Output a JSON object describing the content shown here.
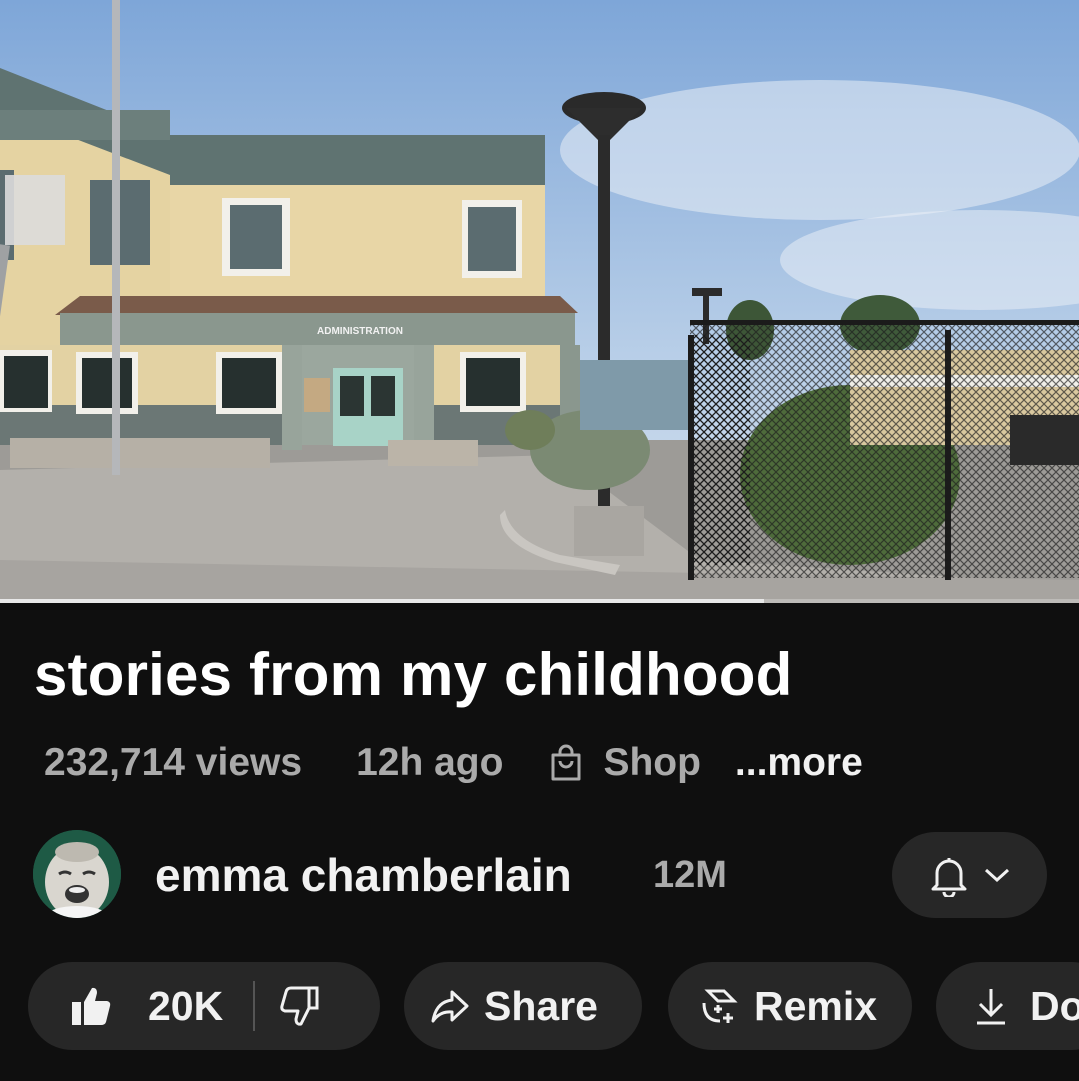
{
  "video": {
    "sign_text": "ADMINISTRATION",
    "progress": 0.708
  },
  "title": "stories from my childhood",
  "meta": {
    "views": "232,714 views",
    "age": "12h ago",
    "shop_label": "Shop",
    "more_label": "...more"
  },
  "channel": {
    "name": "emma chamberlain",
    "subscribers": "12M",
    "avatar_icon": "crying-baby-avatar",
    "bell_icon": "bell-icon"
  },
  "actions": {
    "like_count": "20K",
    "share_label": "Share",
    "remix_label": "Remix",
    "download_label": "Do"
  },
  "colors": {
    "background": "#0f0f0f",
    "pill": "#272727",
    "secondary_text": "#aaaaaa",
    "primary_text": "#f1f1f1"
  }
}
